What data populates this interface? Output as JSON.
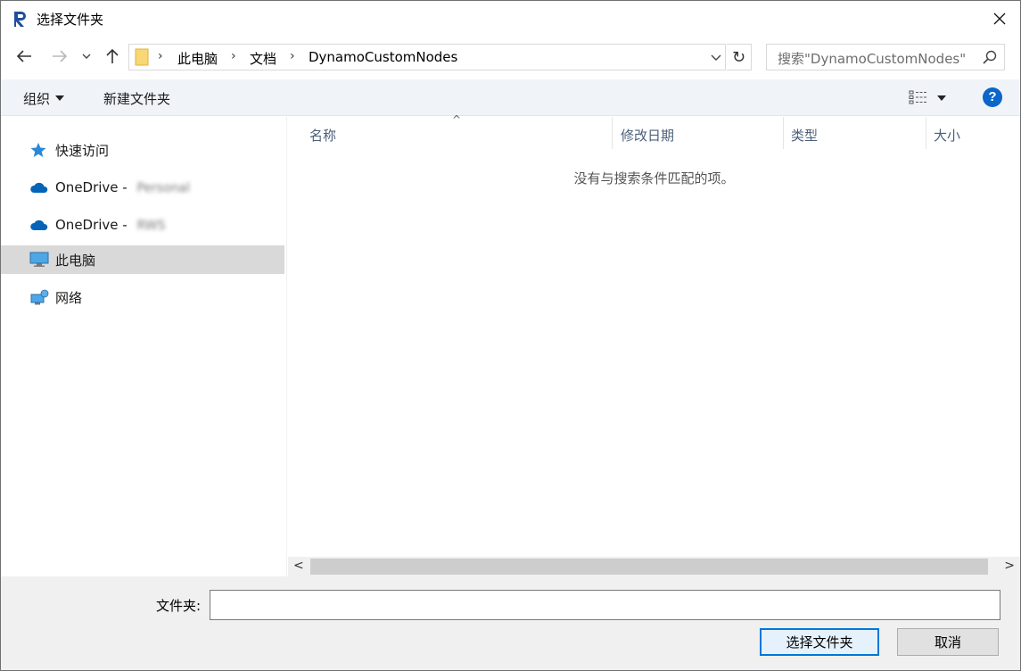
{
  "window": {
    "title": "选择文件夹",
    "app_icon": "revit-r-icon",
    "close_glyph": "✕"
  },
  "navigation": {
    "back_icon": "arrow-left-icon",
    "forward_icon": "arrow-right-icon",
    "recent_icon": "chevron-down-icon",
    "up_icon": "arrow-up-icon"
  },
  "address": {
    "crumbs": [
      "此电脑",
      "文档",
      "DynamoCustomNodes"
    ],
    "separator": "›",
    "refresh_glyph": "↻"
  },
  "search": {
    "placeholder": "搜索\"DynamoCustomNodes\""
  },
  "toolbar": {
    "organize_label": "组织",
    "new_folder_label": "新建文件夹",
    "help_glyph": "?"
  },
  "sidebar": {
    "items": [
      {
        "label": "快速访问",
        "icon": "star-pin-icon",
        "blurred": ""
      },
      {
        "label": "OneDrive - ",
        "icon": "cloud-icon",
        "blurred": "Personal"
      },
      {
        "label": "OneDrive - ",
        "icon": "cloud-icon",
        "blurred": "RWS"
      },
      {
        "label": "此电脑",
        "icon": "computer-icon",
        "blurred": "",
        "selected": true
      },
      {
        "label": "网络",
        "icon": "network-icon",
        "blurred": ""
      }
    ]
  },
  "content": {
    "columns": [
      "名称",
      "修改日期",
      "类型",
      "大小"
    ],
    "sort_glyph": "^",
    "empty_message": "没有与搜索条件匹配的项。"
  },
  "scrollbar": {
    "left_glyph": "<",
    "right_glyph": ">"
  },
  "footer": {
    "folder_label": "文件夹:",
    "folder_value": "",
    "select_button": "选择文件夹",
    "cancel_button": "取消"
  },
  "colors": {
    "accent": "#0078d7",
    "selection": "#d9d9d9",
    "toolbar_bg": "#f0f4f9",
    "folder_yellow": "#f8d775",
    "onedrive_blue": "#0364b8"
  }
}
